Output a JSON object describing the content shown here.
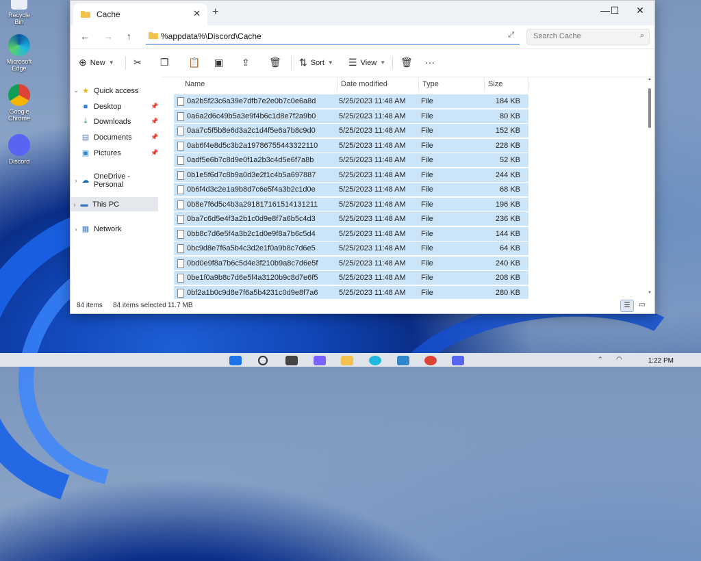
{
  "desktop": {
    "icons": [
      {
        "label": "Recycle Bin",
        "icon": "recycle-bin-icon"
      },
      {
        "label": "Microsoft Edge",
        "icon": "edge-icon"
      },
      {
        "label": "Google Chrome",
        "icon": "chrome-icon"
      },
      {
        "label": "Discord",
        "icon": "discord-icon"
      }
    ]
  },
  "window": {
    "tab_title": "Cache",
    "new_tab": "+",
    "address": "%appdata%\\Discord\\Cache",
    "search_placeholder": "Search Cache"
  },
  "toolbar": {
    "new_label": "New",
    "sort_label": "Sort",
    "view_label": "View",
    "more_label": "···"
  },
  "sidebar": {
    "items": [
      {
        "label": "Quick access",
        "icon": "star-icon",
        "level": 0,
        "expandable": true
      },
      {
        "label": "Desktop",
        "icon": "desktop-folder-icon",
        "level": 1,
        "pinned": true
      },
      {
        "label": "Downloads",
        "icon": "downloads-icon",
        "level": 1,
        "pinned": true
      },
      {
        "label": "Documents",
        "icon": "documents-icon",
        "level": 1,
        "pinned": true
      },
      {
        "label": "Pictures",
        "icon": "pictures-icon",
        "level": 1,
        "pinned": true
      },
      {
        "label": "OneDrive - Personal",
        "icon": "onedrive-icon",
        "level": 0,
        "expandable": true
      },
      {
        "label": "This PC",
        "icon": "this-pc-icon",
        "level": 0,
        "expandable": true,
        "selected": true
      },
      {
        "label": "Network",
        "icon": "network-icon",
        "level": 0,
        "expandable": true
      }
    ]
  },
  "columns": {
    "name": "Name",
    "date": "Date modified",
    "type": "Type",
    "size": "Size"
  },
  "files": [
    {
      "name": "0a2b5f23c6a39e7dfb7e2e0b7c0e6a8d",
      "date": "5/25/2023 11:48 AM",
      "type": "File",
      "size": "184 KB"
    },
    {
      "name": "0a6a2d6c49b5a3e9f4b6c1d8e7f2a9b0",
      "date": "5/25/2023 11:48 AM",
      "type": "File",
      "size": "80 KB"
    },
    {
      "name": "0aa7c5f5b8e6d3a2c1d4f5e6a7b8c9d0",
      "date": "5/25/2023 11:48 AM",
      "type": "File",
      "size": "152 KB"
    },
    {
      "name": "0ab6f4e8d5c3b2a19786755443322110",
      "date": "5/25/2023 11:48 AM",
      "type": "File",
      "size": "228 KB"
    },
    {
      "name": "0adf5e6b7c8d9e0f1a2b3c4d5e6f7a8b",
      "date": "5/25/2023 11:48 AM",
      "type": "File",
      "size": "52 KB"
    },
    {
      "name": "0b1e5f6d7c8b9a0d3e2f1c4b5a697887",
      "date": "5/25/2023 11:48 AM",
      "type": "File",
      "size": "244 KB"
    },
    {
      "name": "0b6f4d3c2e1a9b8d7c6e5f4a3b2c1d0e",
      "date": "5/25/2023 11:48 AM",
      "type": "File",
      "size": "68 KB"
    },
    {
      "name": "0b8e7f6d5c4b3a291817161514131211",
      "date": "5/25/2023 11:48 AM",
      "type": "File",
      "size": "196 KB"
    },
    {
      "name": "0ba7c6d5e4f3a2b1c0d9e8f7a6b5c4d3",
      "date": "5/25/2023 11:48 AM",
      "type": "File",
      "size": "236 KB"
    },
    {
      "name": "0bb8c7d6e5f4a3b2c1d0e9f8a7b6c5d4",
      "date": "5/25/2023 11:48 AM",
      "type": "File",
      "size": "144 KB"
    },
    {
      "name": "0bc9d8e7f6a5b4c3d2e1f0a9b8c7d6e5",
      "date": "5/25/2023 11:48 AM",
      "type": "File",
      "size": "64 KB"
    },
    {
      "name": "0bd0e9f8a7b6c5d4e3f210b9a8c7d6e5f",
      "date": "5/25/2023 11:48 AM",
      "type": "File",
      "size": "240 KB"
    },
    {
      "name": "0be1f0a9b8c7d6e5f4a3120b9c8d7e6f5",
      "date": "5/25/2023 11:48 AM",
      "type": "File",
      "size": "208 KB"
    },
    {
      "name": "0bf2a1b0c9d8e7f6a5b4231c0d9e8f7a6",
      "date": "5/25/2023 11:48 AM",
      "type": "File",
      "size": "280 KB"
    }
  ],
  "status": {
    "items": "84 items",
    "selected": "84 items selected",
    "size": "11.7 MB"
  },
  "taskbar": {
    "clock": "1:22 PM"
  },
  "colors": {
    "selection": "#cce4f7",
    "accent": "#2c6cd6",
    "folder": "#f2c14e"
  }
}
